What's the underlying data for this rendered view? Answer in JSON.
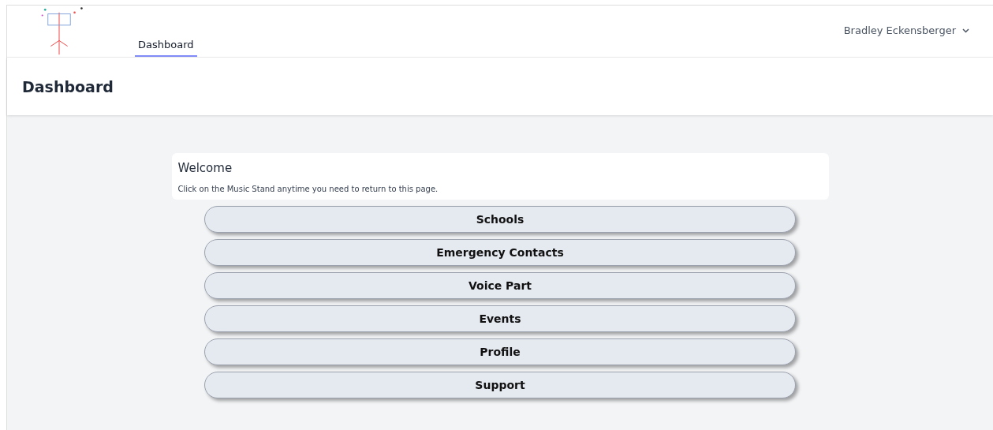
{
  "nav": {
    "links": [
      {
        "label": "Dashboard",
        "selected": true
      }
    ],
    "user": {
      "name": "Bradley Eckensberger"
    }
  },
  "header": {
    "title": "Dashboard"
  },
  "welcome": {
    "title": "Welcome",
    "text": "Click on the Music Stand anytime you need to return to this page."
  },
  "buttons": [
    "Schools",
    "Emergency Contacts",
    "Voice Part",
    "Events",
    "Profile",
    "Support"
  ]
}
